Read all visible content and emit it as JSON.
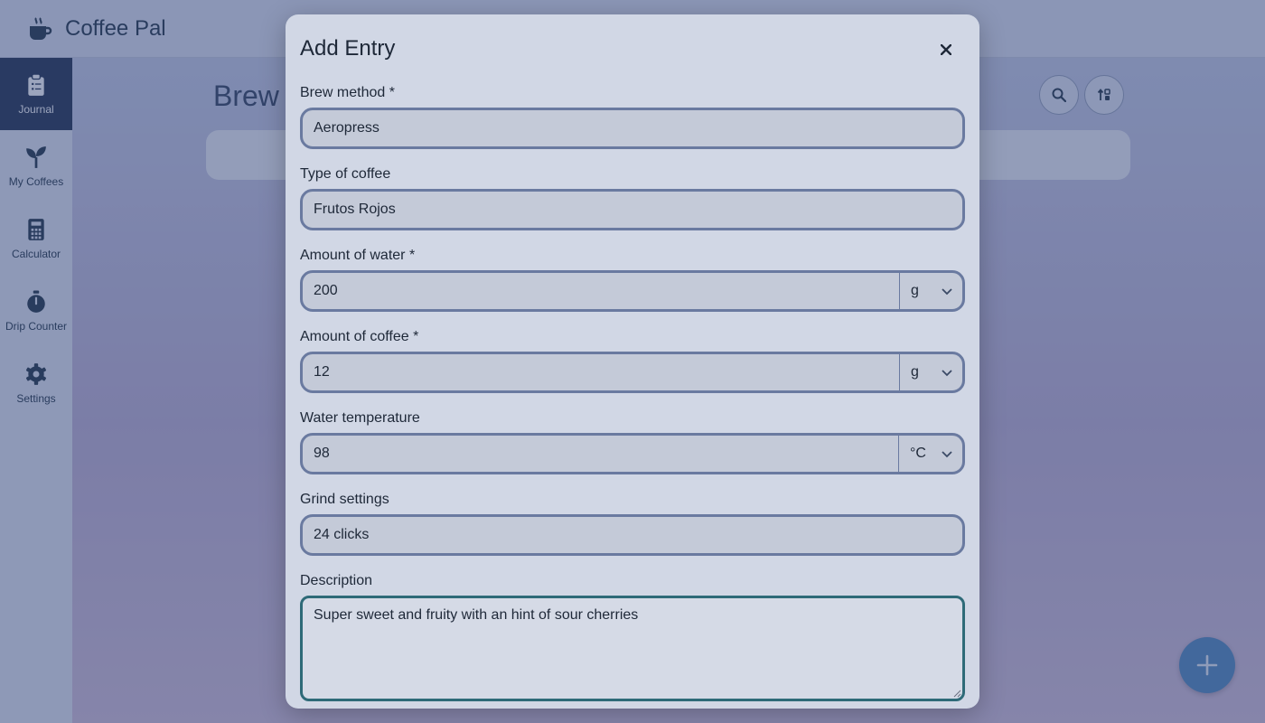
{
  "app": {
    "title": "Coffee Pal",
    "logo_icon": "coffee-cup-icon"
  },
  "sidebar": {
    "items": [
      {
        "label": "Journal",
        "icon": "clipboard-icon",
        "active": true
      },
      {
        "label": "My Coffees",
        "icon": "sprout-icon",
        "active": false
      },
      {
        "label": "Calculator",
        "icon": "calculator-icon",
        "active": false
      },
      {
        "label": "Drip Counter",
        "icon": "stopwatch-icon",
        "active": false
      },
      {
        "label": "Settings",
        "icon": "gear-icon",
        "active": false
      }
    ]
  },
  "main": {
    "heading": "Brew",
    "search_icon": "search-icon",
    "sort_icon": "sort-icon",
    "fab_icon": "plus-icon"
  },
  "modal": {
    "title": "Add Entry",
    "close_icon": "close-icon",
    "fields": {
      "brew_method": {
        "label": "Brew method *",
        "value": "Aeropress"
      },
      "coffee_type": {
        "label": "Type of coffee",
        "value": "Frutos Rojos"
      },
      "water_amount": {
        "label": "Amount of water *",
        "value": "200",
        "unit": "g"
      },
      "coffee_amount": {
        "label": "Amount of coffee *",
        "value": "12",
        "unit": "g"
      },
      "water_temp": {
        "label": "Water temperature",
        "value": "98",
        "unit": "°C"
      },
      "grind": {
        "label": "Grind settings",
        "value": "24 clicks"
      },
      "description": {
        "label": "Description",
        "value": "Super sweet and fruity with an hint of sour cherries"
      }
    }
  },
  "colors": {
    "accent": "#2b3a57",
    "focus_border": "#2e6a78",
    "input_border": "#6a7aa0",
    "fab": "#5a8fc2"
  }
}
